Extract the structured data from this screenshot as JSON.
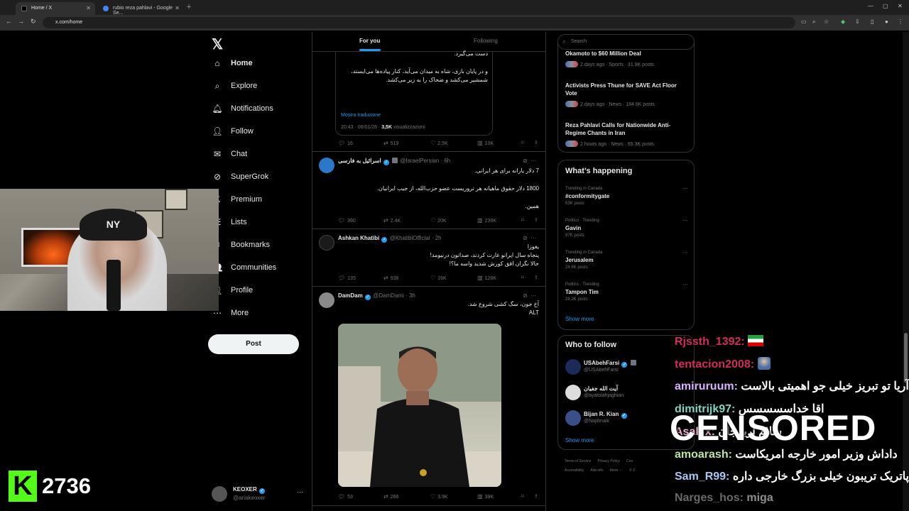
{
  "browser": {
    "tabs": [
      {
        "label": "Home / X"
      },
      {
        "label": "rubio reza pahlavi - Google Se..."
      }
    ],
    "url": "x.com/home"
  },
  "nav": {
    "items": [
      {
        "label": "Home",
        "icon": "home-icon"
      },
      {
        "label": "Explore",
        "icon": "search-icon"
      },
      {
        "label": "Notifications",
        "icon": "bell-icon"
      },
      {
        "label": "Follow",
        "icon": "person-add-icon"
      },
      {
        "label": "Chat",
        "icon": "mail-icon"
      },
      {
        "label": "SuperGrok",
        "icon": "grok-icon"
      },
      {
        "label": "Premium",
        "icon": "x-icon"
      },
      {
        "label": "Lists",
        "icon": "list-icon"
      },
      {
        "label": "Bookmarks",
        "icon": "bookmark-icon"
      },
      {
        "label": "Communities",
        "icon": "people-icon"
      },
      {
        "label": "Profile",
        "icon": "profile-icon"
      },
      {
        "label": "More",
        "icon": "more-circle-icon"
      }
    ],
    "post_label": "Post",
    "account": {
      "name": "KEOXER",
      "handle": "@ariakeoxer"
    }
  },
  "timeline": {
    "tabs": {
      "for_you": "For you",
      "following": "Following"
    },
    "quote": {
      "line1": "دست می‌گیرد.",
      "line2": "و در پایان بازی، شاه به میدان می‌آید، کنار پیاده‌ها می‌ایستد،",
      "line3": "شمشیر می‌کشد و ضحاک را به زیر می‌کشد.",
      "translate": "Mostra traduzione",
      "time": "20:43 · 06/01/26 · ",
      "views_count": "3,5K",
      "views_label": " visualizzazioni"
    },
    "quote_actions": {
      "replies": "16",
      "reposts": "519",
      "likes": "2.5K",
      "views": "10K"
    },
    "tweets": [
      {
        "name": "اسرائیل به فارسی",
        "handle": "@IsraelPersian · 6h",
        "lines": [
          "7 دلار یارانه برای هر ایرانی.",
          "1800 دلار حقوق ماهیانه هر تروریست عضو حزب‌الله، از جیب ایرانیان.",
          "همین."
        ],
        "replies": "390",
        "reposts": "2.4K",
        "likes": "20K",
        "views": "239K"
      },
      {
        "name": "Ashkan Khatibi",
        "handle": "@KhatibiOfficial · 2h",
        "lines": [
          "یغوزا",
          "پنجاه سال ایرانو غارت کردند، صداتون درنیومد!",
          "حالا نگران افق کورش شدید واسه ما؟!"
        ],
        "replies": "135",
        "reposts": "938",
        "likes": "16K",
        "views": "128K"
      },
      {
        "name": "DamDam",
        "handle": "@DamDami · 3h",
        "lines": [
          "آخ جون، سگ کشی شروع شد.",
          "ALT"
        ],
        "replies": "53",
        "reposts": "266",
        "likes": "3.9K",
        "views": "39K"
      }
    ]
  },
  "right": {
    "search_placeholder": "Search",
    "news": [
      {
        "title": "Okamoto to $60 Million Deal",
        "meta": "2 days ago · Sports · 31.9K posts"
      },
      {
        "title": "Activists Press Thune for SAVE Act Floor Vote",
        "meta": "2 days ago · News · 184.6K posts"
      },
      {
        "title": "Reza Pahlavi Calls for Nationwide Anti-Regime Chants in Iran",
        "meta": "2 hours ago · News · 65.3K posts"
      }
    ],
    "whats_happening": {
      "title": "What’s happening",
      "trends": [
        {
          "context": "Trending in Canada",
          "name": "#conformitygate",
          "count": "53K posts"
        },
        {
          "context": "Politics · Trending",
          "name": "Gavin",
          "count": "97K posts"
        },
        {
          "context": "Trending in Canada",
          "name": "Jerusalem",
          "count": "24.6K posts"
        },
        {
          "context": "Politics · Trending",
          "name": "Tampon Tim",
          "count": "28.2K posts"
        }
      ],
      "show_more": "Show more"
    },
    "who_to_follow": {
      "title": "Who to follow",
      "users": [
        {
          "name": "USAbehFarsi",
          "handle": "@USAbehFarsi"
        },
        {
          "name": "آیت الله جفیان",
          "handle": "@ayatolahjaghian"
        },
        {
          "name": "Bijan R. Kian",
          "handle": "@Najibnaik"
        }
      ],
      "show_more": "Show more"
    },
    "footer": {
      "line1": [
        "Terms of Service",
        "Privacy Policy",
        "Coo"
      ],
      "line2": [
        "Accessibility",
        "Ads info",
        "More ···",
        "© 2"
      ]
    }
  },
  "stream": {
    "kick_count": "2736",
    "cap_logo": "NY",
    "censored_label": "CENSORED",
    "chat": [
      {
        "user": "Rjssth_1392:",
        "msg": "",
        "color": "#d12c5a",
        "emote": "flag"
      },
      {
        "user": "tentacion2008:",
        "msg": "",
        "color": "#d12c5a",
        "emote": "image"
      },
      {
        "user": "amiruruum:",
        "msg": "آریا تو تبریز خیلی جو اهمیتی بالاست",
        "color": "#d9b3ff",
        "emote": ""
      },
      {
        "user": "dimitrijk97:",
        "msg": "اقا خداسسسسس",
        "color": "#7fd6c0",
        "emote": ""
      },
      {
        "user": "Asallix:",
        "msg": "سلام آریا جان",
        "color": "#f5b3d4",
        "emote": ""
      },
      {
        "user": "amoarash:",
        "msg": "داداش وزیر امور خارجه امریکاست",
        "color": "#b9e6a5",
        "emote": ""
      },
      {
        "user": "Sam_R99:",
        "msg": "پاتریک تریبون خیلی بزرگ خارجی داره",
        "color": "#a5c8f5",
        "emote": ""
      },
      {
        "user": "Narges_hos:",
        "msg": "miga",
        "color": "#bfbfbf",
        "emote": ""
      }
    ]
  }
}
